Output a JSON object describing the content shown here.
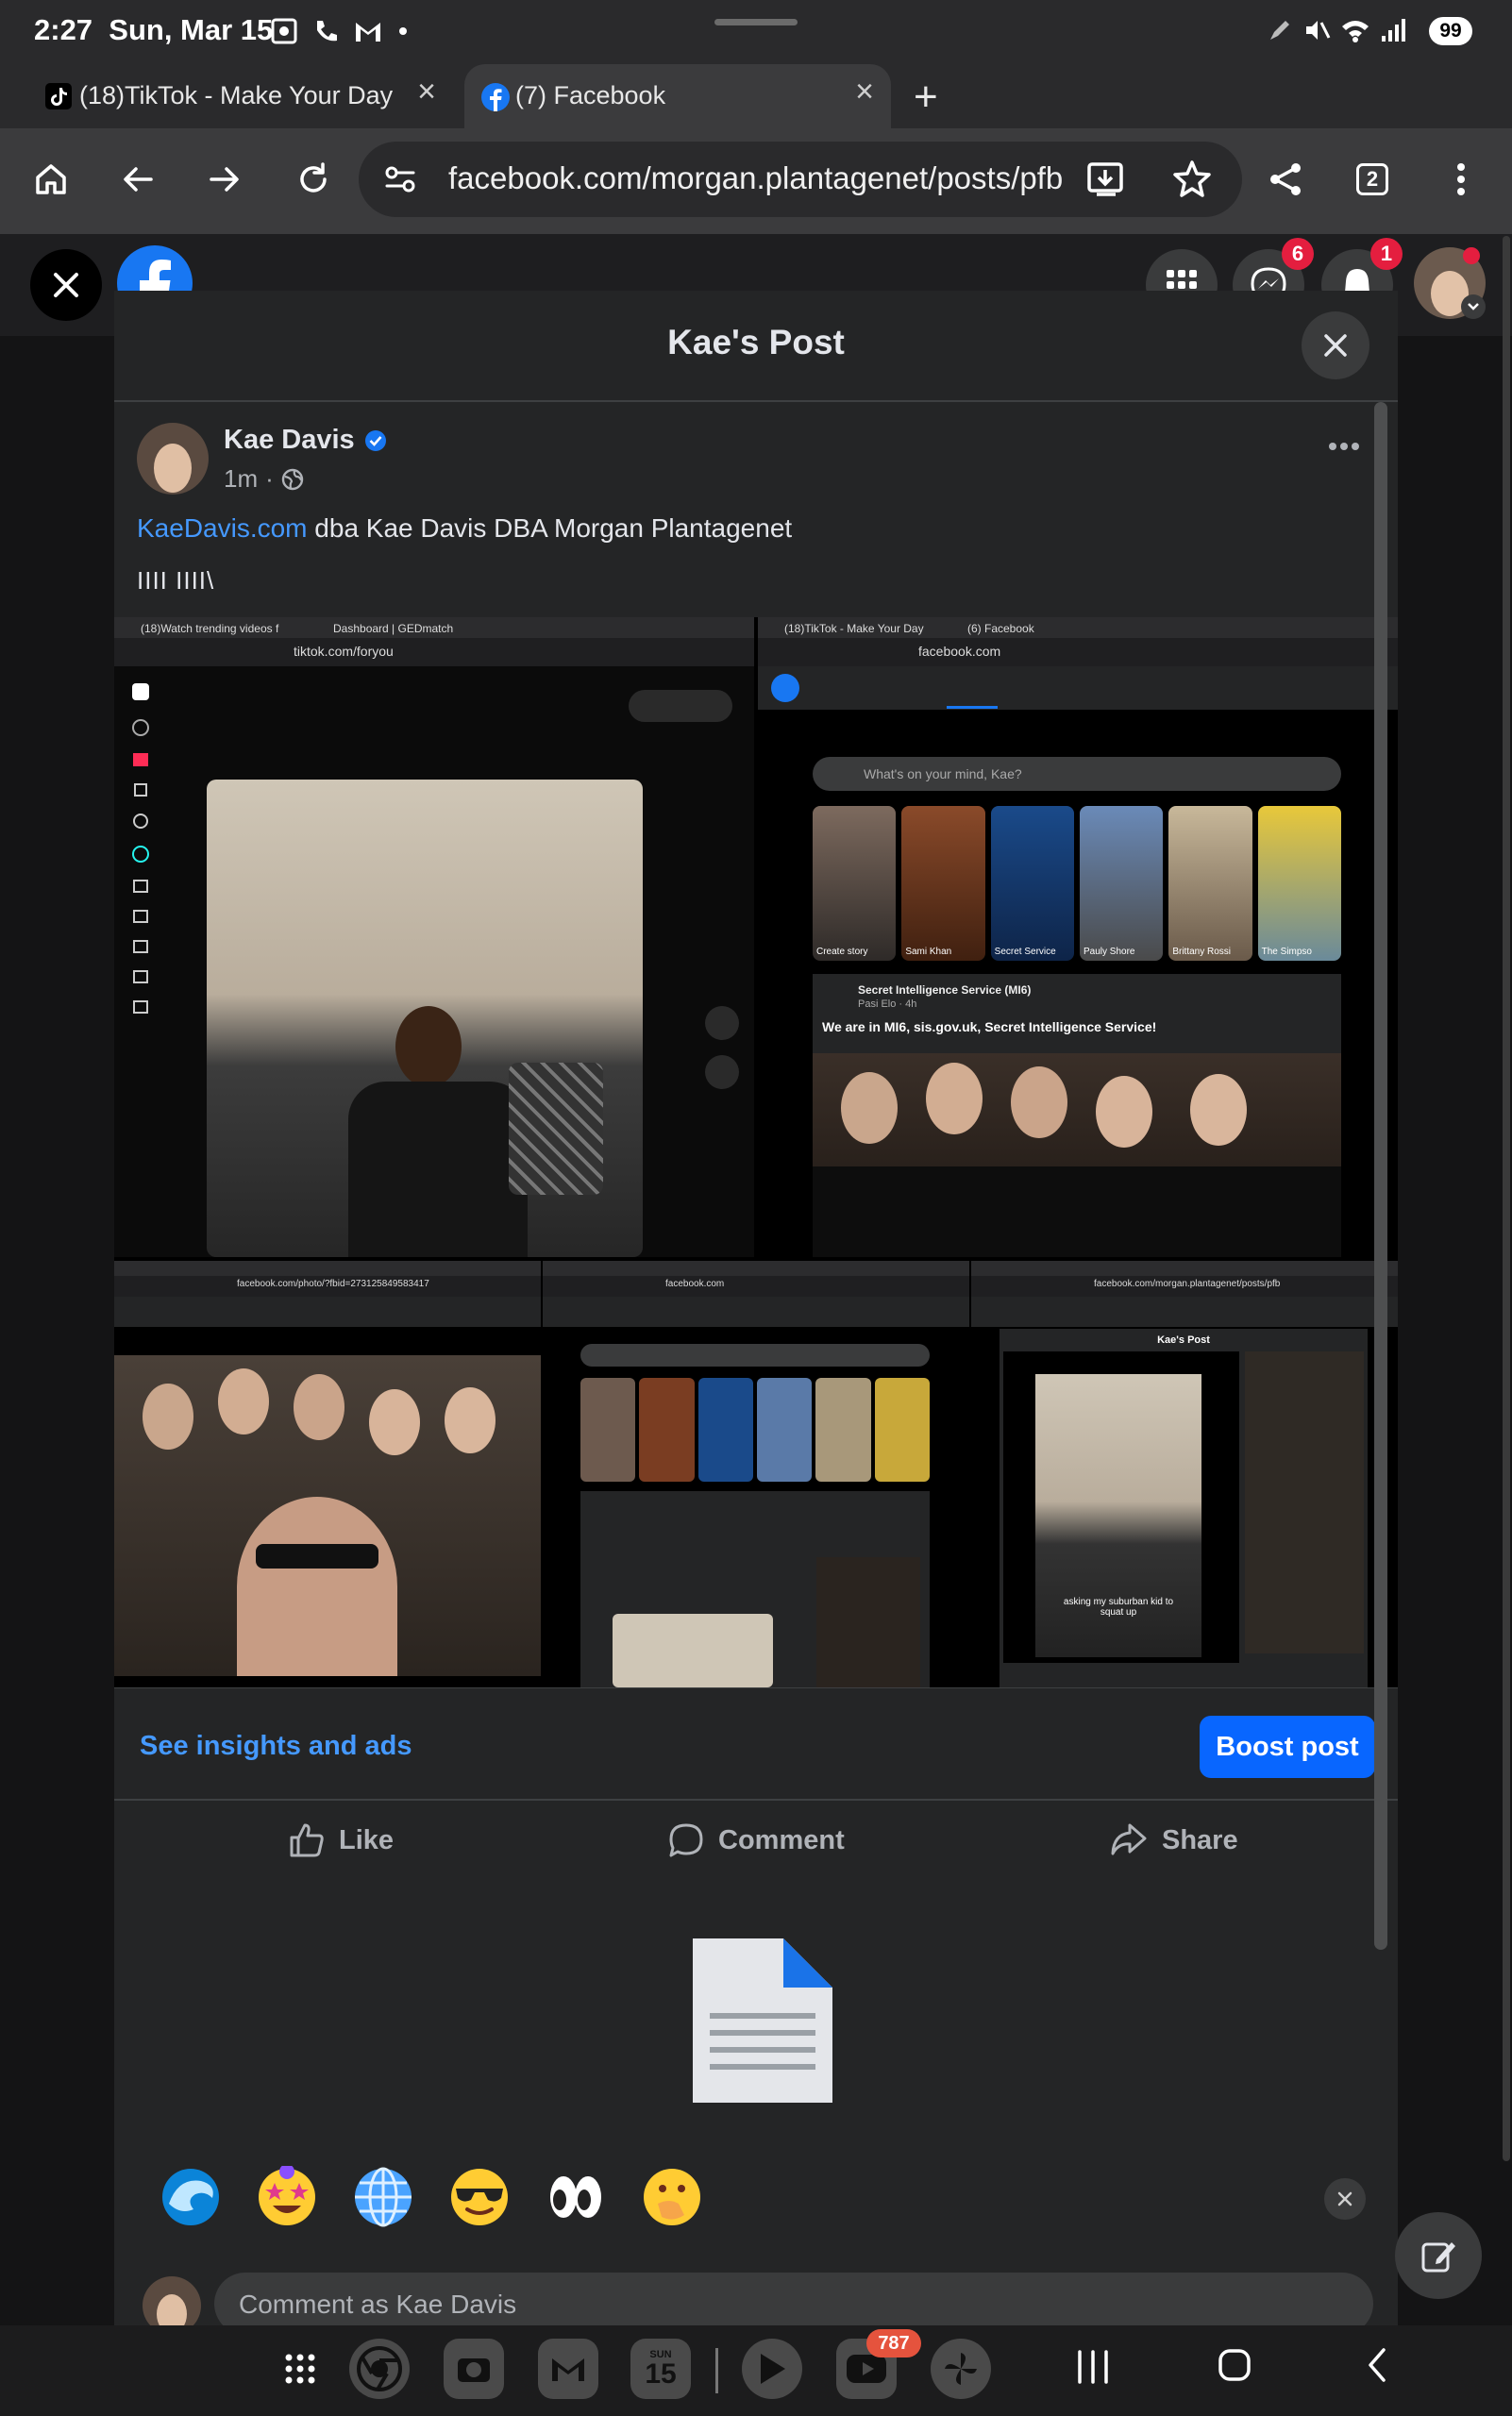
{
  "status_bar": {
    "time": "2:27",
    "date": "Sun, Mar 15",
    "battery": "99"
  },
  "tabs": [
    {
      "label": "(18)TikTok - Make Your Day"
    },
    {
      "label": "(7) Facebook"
    }
  ],
  "toolbar": {
    "url": "facebook.com/morgan.plantagenet/posts/pfb",
    "tab_count": "2"
  },
  "fb_header": {
    "messenger_badge": "6",
    "notifications_badge": "1"
  },
  "modal": {
    "title": "Kae's Post",
    "author": "Kae Davis",
    "time": "1m",
    "link_text": "KaeDavis.com",
    "body_text": " dba Kae Davis DBA Morgan Plantagenet",
    "tally": "IIII IIII\\",
    "insights_label": "See insights and ads",
    "boost_label": "Boost post",
    "like_label": "Like",
    "comment_label": "Comment",
    "share_label": "Share",
    "comment_placeholder": "Comment as Kae Davis"
  },
  "screenshots": {
    "s1": {
      "tab1": "(18)Watch trending videos f",
      "tab2": "Dashboard | GEDmatch",
      "url": "tiktok.com/foryou"
    },
    "s2": {
      "tab1": "(18)TikTok - Make Your Day",
      "tab2": "(6) Facebook",
      "url": "facebook.com",
      "composer": "What's on your mind, Kae?",
      "stories": [
        "Create story",
        "Sami Khan",
        "Secret Service",
        "Pauly Shore",
        "Brittany Rossi",
        "The Simpso"
      ],
      "page_name": "Secret Intelligence Service (MI6)",
      "page_sub": "Pasi Elo · 4h",
      "post_text": "We are in MI6, sis.gov.uk, Secret Intelligence Service!"
    },
    "s3": {
      "url": "facebook.com/photo/?fbid=273125849583417"
    },
    "s4": {
      "url": "facebook.com"
    },
    "s5": {
      "url": "facebook.com/morgan.plantagenet/posts/pfb",
      "title": "Kae's Post",
      "caption": "asking my suburban kid to squat up"
    }
  },
  "emojis": [
    "wave",
    "star-struck",
    "globe",
    "sunglasses",
    "eyes",
    "hand-over-mouth"
  ],
  "nav": {
    "youtube_badge": "787",
    "calendar_day": "15",
    "calendar_dow": "SUN"
  }
}
